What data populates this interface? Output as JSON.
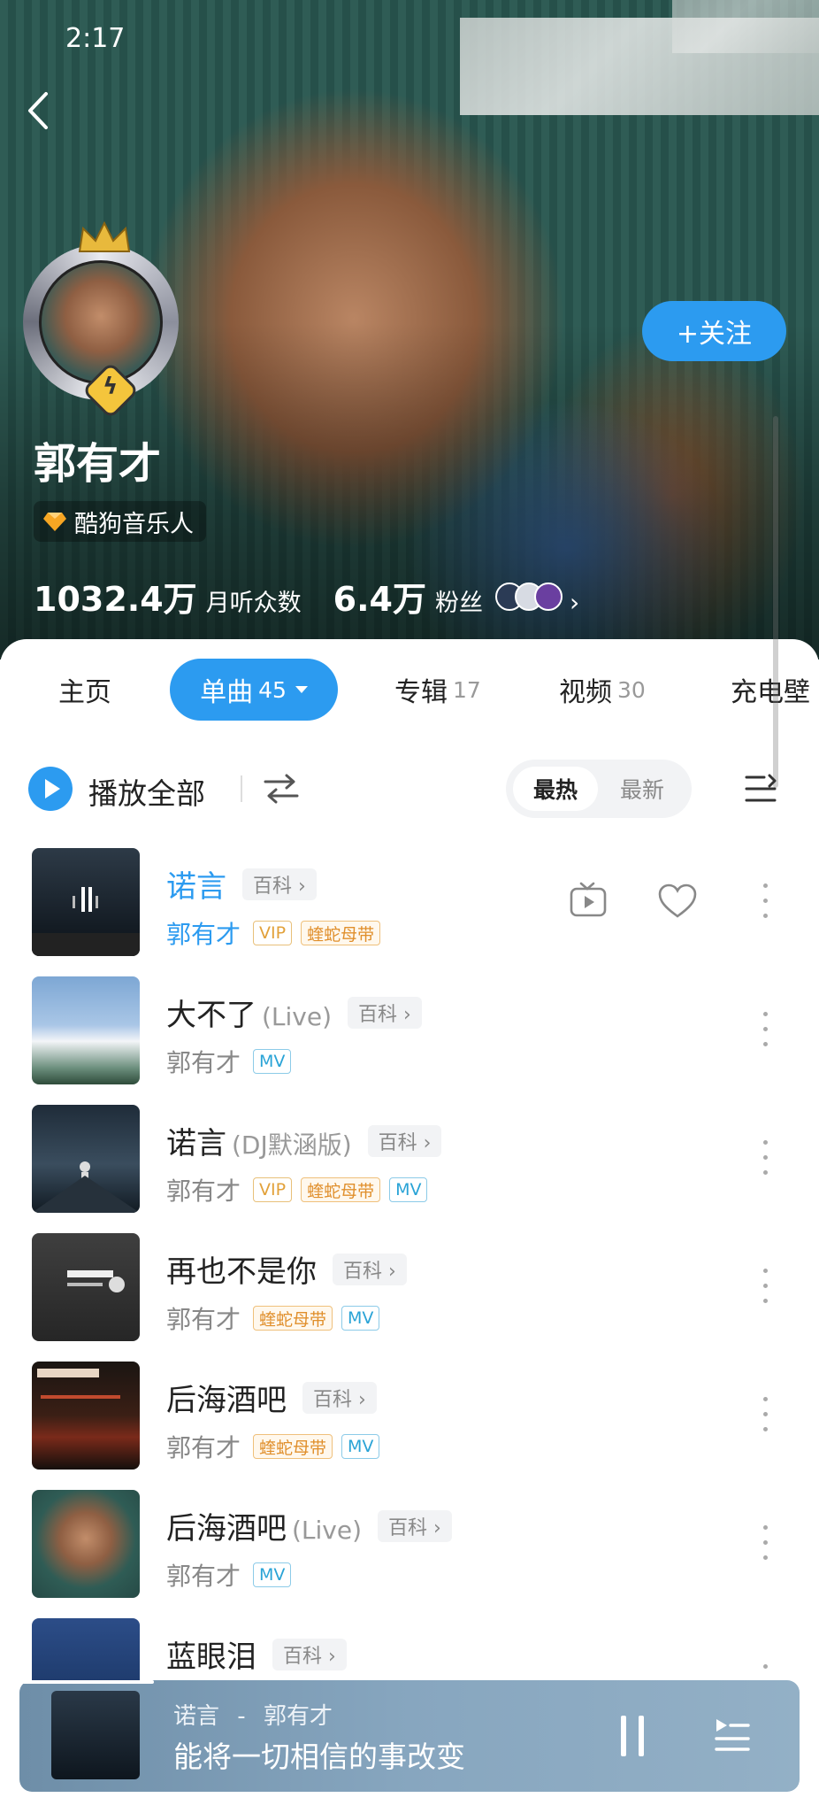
{
  "status_bar": {
    "time": "2:17"
  },
  "artist": {
    "name": "郭有才",
    "tag": "酷狗音乐人",
    "monthly_listeners": "1032.4万",
    "monthly_listeners_label": "月听众数",
    "fans": "6.4万",
    "fans_label": "粉丝",
    "follow_label": "+关注"
  },
  "tabs": [
    {
      "label": "主页",
      "count": ""
    },
    {
      "label": "单曲",
      "count": "45"
    },
    {
      "label": "专辑",
      "count": "17"
    },
    {
      "label": "视频",
      "count": "30"
    },
    {
      "label": "充电壁",
      "count": ""
    }
  ],
  "toolbar": {
    "play_all": "播放全部",
    "sort_hot": "最热",
    "sort_new": "最新"
  },
  "songs": [
    {
      "title": "诺言",
      "suffix": "",
      "baike": "百科 ›",
      "artist": "郭有才",
      "tags": [
        "VIP",
        "蝰蛇母带"
      ]
    },
    {
      "title": "大不了",
      "suffix": "(Live)",
      "baike": "百科 ›",
      "artist": "郭有才",
      "tags": [
        "MV"
      ]
    },
    {
      "title": "诺言",
      "suffix": "(DJ默涵版)",
      "baike": "百科 ›",
      "artist": "郭有才",
      "tags": [
        "VIP",
        "蝰蛇母带",
        "MV"
      ]
    },
    {
      "title": "再也不是你",
      "suffix": "",
      "baike": "百科 ›",
      "artist": "郭有才",
      "tags": [
        "蝰蛇母带",
        "MV"
      ]
    },
    {
      "title": "后海酒吧",
      "suffix": "",
      "baike": "百科 ›",
      "artist": "郭有才",
      "tags": [
        "蝰蛇母带",
        "MV"
      ]
    },
    {
      "title": "后海酒吧",
      "suffix": "(Live)",
      "baike": "百科 ›",
      "artist": "郭有才",
      "tags": [
        "MV"
      ]
    },
    {
      "title": "蓝眼泪",
      "suffix": "",
      "baike": "百科 ›",
      "artist": "",
      "tags": []
    }
  ],
  "player": {
    "song_title": "诺言",
    "separator": "-",
    "song_artist": "郭有才",
    "lyric": "能将一切相信的事改变"
  },
  "colors": {
    "accent": "#2c9bf0",
    "vip": "#e2a13a",
    "mv": "#29a3d6"
  },
  "icons": [
    "back-arrow-icon",
    "crown-icon",
    "lightning-badge-icon",
    "diamond-icon",
    "chevron-right-icon",
    "play-circle-icon",
    "shuffle-icon",
    "list-icon",
    "video-icon",
    "heart-icon",
    "more-vertical-icon",
    "pause-icon",
    "queue-icon"
  ]
}
